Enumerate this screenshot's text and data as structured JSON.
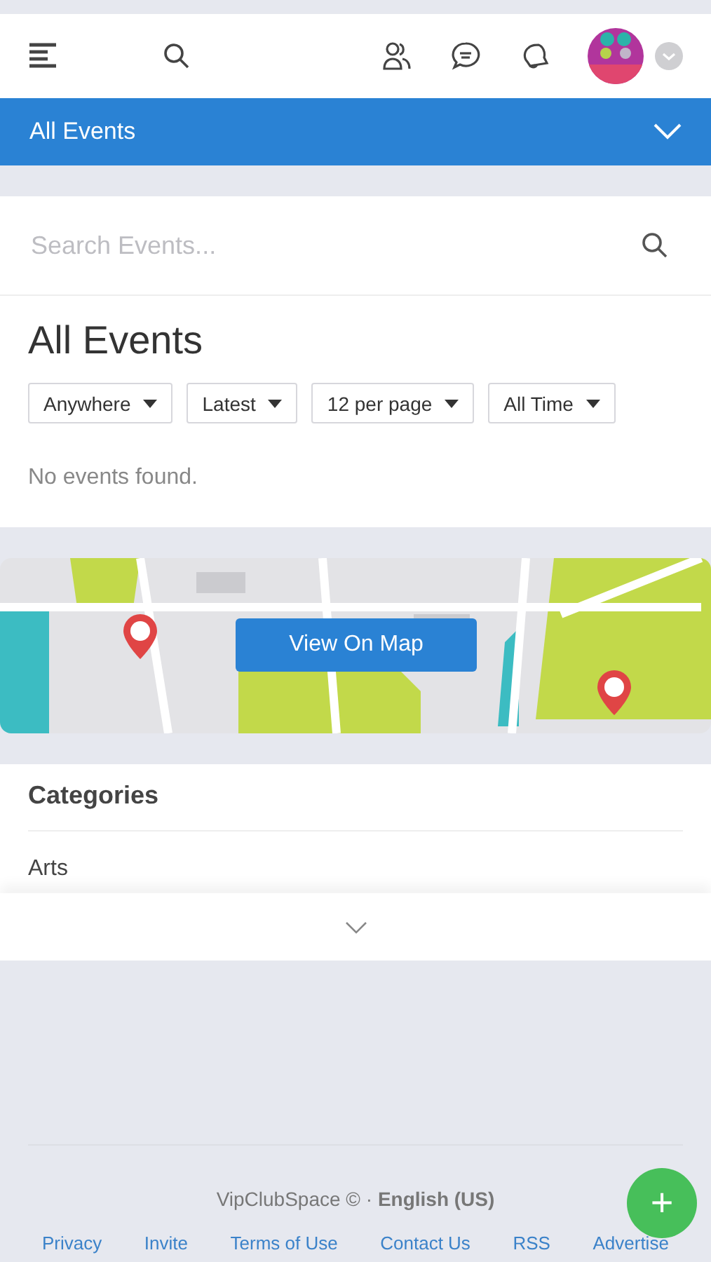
{
  "header": {
    "title": "All Events"
  },
  "search": {
    "placeholder": "Search Events..."
  },
  "events": {
    "title": "All Events",
    "filters": [
      "Anywhere",
      "Latest",
      "12 per page",
      "All Time"
    ],
    "empty_message": "No events found."
  },
  "map": {
    "button": "View On Map"
  },
  "categories": {
    "title": "Categories",
    "items": [
      "Arts"
    ]
  },
  "footer": {
    "brand": "VipClubSpace © · ",
    "language": "English (US)",
    "links": [
      "Privacy",
      "Invite",
      "Terms of Use",
      "Contact Us",
      "RSS",
      "Advertise"
    ]
  },
  "fab": {
    "label": "+"
  }
}
